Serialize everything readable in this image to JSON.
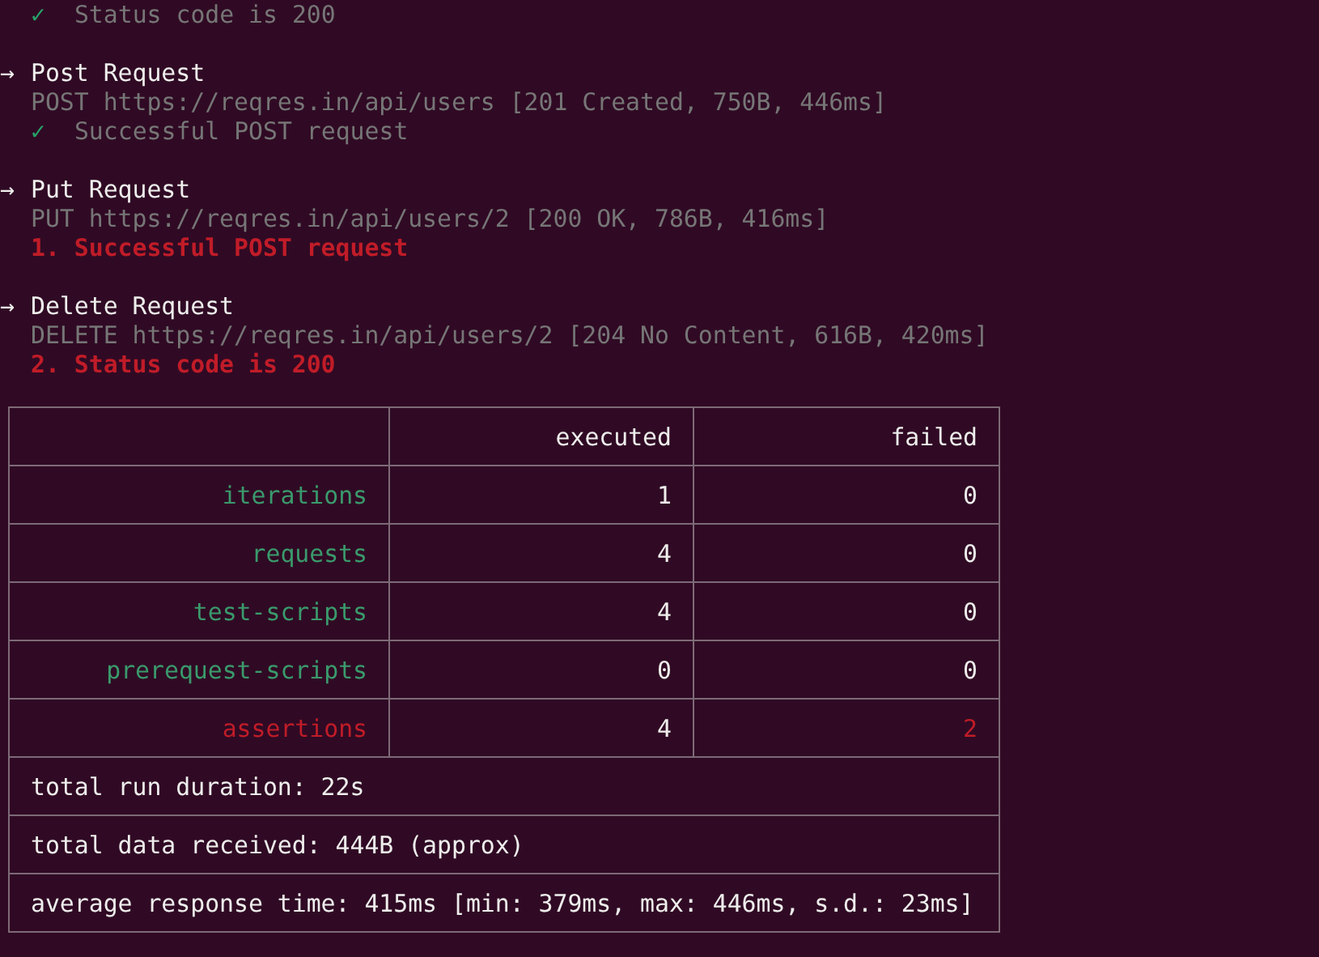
{
  "previous_result": {
    "kind": "pass",
    "mark": "✓",
    "text": "Status code is 200"
  },
  "requests": [
    {
      "arrow": "→",
      "name": "Post Request",
      "request_line": "POST https://reqres.in/api/users [201 Created, 750B, 446ms]",
      "results": [
        {
          "kind": "pass",
          "mark": "✓",
          "text": "Successful POST request"
        }
      ]
    },
    {
      "arrow": "→",
      "name": "Put Request",
      "request_line": "PUT https://reqres.in/api/users/2 [200 OK, 786B, 416ms]",
      "results": [
        {
          "kind": "fail",
          "text": "1. Successful POST request"
        }
      ]
    },
    {
      "arrow": "→",
      "name": "Delete Request",
      "request_line": "DELETE https://reqres.in/api/users/2 [204 No Content, 616B, 420ms]",
      "results": [
        {
          "kind": "fail",
          "text": "2. Status code is 200"
        }
      ]
    }
  ],
  "summary_table": {
    "columns": [
      "executed",
      "failed"
    ],
    "rows": [
      {
        "label": "iterations",
        "executed": "1",
        "failed": "0",
        "kind": "ok"
      },
      {
        "label": "requests",
        "executed": "4",
        "failed": "0",
        "kind": "ok"
      },
      {
        "label": "test-scripts",
        "executed": "4",
        "failed": "0",
        "kind": "ok"
      },
      {
        "label": "prerequest-scripts",
        "executed": "0",
        "failed": "0",
        "kind": "ok"
      },
      {
        "label": "assertions",
        "executed": "4",
        "failed": "2",
        "kind": "fail"
      }
    ],
    "footer": [
      "total run duration: 22s",
      "total data received: 444B (approx)",
      "average response time: 415ms [min: 379ms, max: 446ms, s.d.: 23ms]"
    ]
  }
}
